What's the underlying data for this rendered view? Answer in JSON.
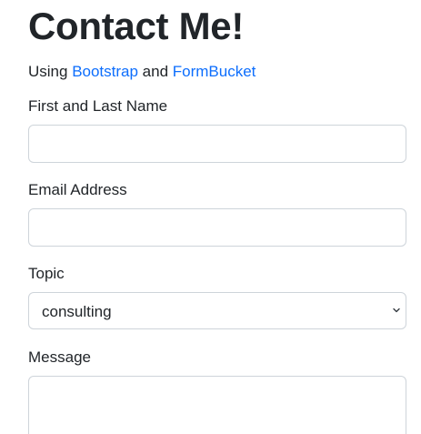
{
  "heading": "Contact Me!",
  "subtitle": {
    "prefix": "Using ",
    "link1": "Bootstrap",
    "middle": " and ",
    "link2": "FormBucket"
  },
  "form": {
    "name_label": "First and Last Name",
    "name_value": "",
    "email_label": "Email Address",
    "email_value": "",
    "topic_label": "Topic",
    "topic_selected": "consulting",
    "message_label": "Message",
    "message_value": ""
  },
  "icons": {
    "select_arrow": "chevron-down-icon"
  },
  "colors": {
    "link": "#0d6efd",
    "text": "#212529",
    "border": "#ced4da"
  }
}
